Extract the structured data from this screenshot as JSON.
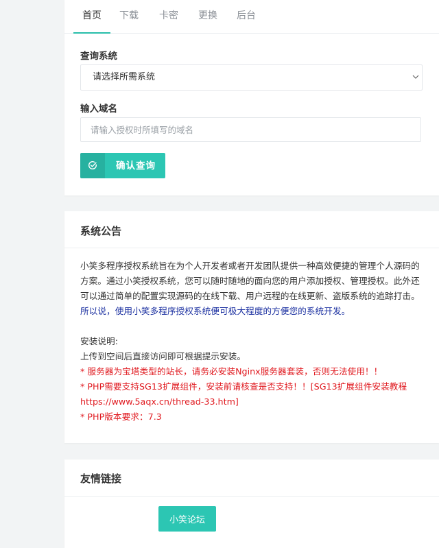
{
  "tabs": [
    {
      "label": "首页",
      "active": true
    },
    {
      "label": "下载",
      "active": false
    },
    {
      "label": "卡密",
      "active": false
    },
    {
      "label": "更换",
      "active": false
    },
    {
      "label": "后台",
      "active": false
    }
  ],
  "query": {
    "system_label": "查询系统",
    "system_select_value": "请选择所需系统",
    "domain_label": "输入域名",
    "domain_placeholder": "请输入授权时所填写的域名",
    "confirm_label": "确认查询"
  },
  "notice": {
    "title": "系统公告",
    "intro": "小笑多程序授权系统旨在为个人开发者或者开发团队提供一种高效便捷的管理个人源码的方案。通过小笑授权系统，您可以随时随地的面向您的用户添加授权、管理授权。此外还可以通过简单的配置实现源码的在线下载、用户远程的在线更新、盗版系统的追踪打击。",
    "intro_highlight": "所以说，使用小笑多程序授权系统便可极大程度的方便您的系统开发。",
    "install_title": "安装说明:",
    "install_step": "上传到空间后直接访问即可根据提示安装。",
    "warnings": [
      "* 服务器为宝塔类型的站长，请务必安装Nginx服务器套装，否则无法使用！！",
      "* PHP需要支持SG13扩展组件，安装前请核查是否支持！！[SG13扩展组件安装教程https://www.5aqx.cn/thread-33.htm]",
      "* PHP版本要求：7.3"
    ]
  },
  "links": {
    "title": "友情链接",
    "items": [
      {
        "label": "小笑论坛"
      }
    ]
  },
  "colors": {
    "accent": "#2cc6b3",
    "highlight_text": "#1a2fa0",
    "warning_text": "#e0191f"
  }
}
